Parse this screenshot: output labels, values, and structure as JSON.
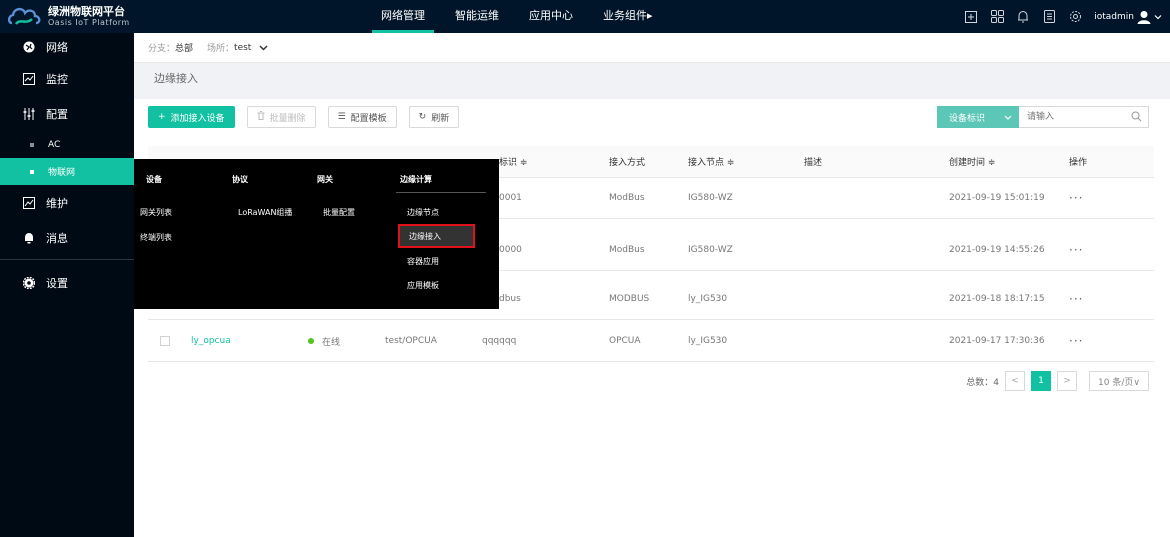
{
  "brand": {
    "title": "绿洲物联网平台",
    "subtitle": "Oasis IoT Platform",
    "accent": "#12c0a2",
    "logo_icon": "cloud-logo-icon"
  },
  "top_nav": {
    "items": [
      {
        "label": "网络管理",
        "active": true
      },
      {
        "label": "智能运维",
        "active": false
      },
      {
        "label": "应用中心",
        "active": false
      },
      {
        "label": "业务组件▸",
        "active": false
      }
    ]
  },
  "top_right": {
    "icons": [
      "fullscreen-icon",
      "apps-grid-icon",
      "bell-icon",
      "document-icon",
      "settings-gear-icon"
    ],
    "username": "iotadmin"
  },
  "sidebar": {
    "items": [
      {
        "label": "网络",
        "icon": "globe-icon"
      },
      {
        "label": "监控",
        "icon": "monitor-icon"
      },
      {
        "label": "配置",
        "icon": "sliders-icon"
      },
      {
        "label": "AC",
        "sub": true
      },
      {
        "label": "物联网",
        "sub": true,
        "active": true
      },
      {
        "label": "维护",
        "icon": "maintenance-icon"
      },
      {
        "label": "消息",
        "icon": "bell-icon"
      },
      {
        "label": "设置",
        "icon": "gear-icon"
      }
    ]
  },
  "breadcrumb": {
    "branch_label": "分支：",
    "branch_value": "总部",
    "site_label": "场所：",
    "site_value": "test"
  },
  "page_title": "边缘接入",
  "toolbar": {
    "add_label": "添加接入设备",
    "batch_delete_label": "批量删除",
    "template_label": "配置模板",
    "refresh_label": "刷新"
  },
  "search": {
    "select_label": "设备标识",
    "placeholder": "请输入"
  },
  "table": {
    "headers": {
      "identifier": "标识 ≑",
      "access_method": "接入方式",
      "access_node": "接入节点 ≑",
      "description": "描述",
      "created": "创建时间 ≑",
      "actions": "操作"
    },
    "rows": [
      {
        "name": "",
        "status": "",
        "path": "",
        "identifier": "0001",
        "method": "ModBus",
        "node": "IG580-WZ",
        "created": "2021-09-19 15:01:19"
      },
      {
        "name": "",
        "status": "",
        "path": "",
        "identifier": "0000",
        "method": "ModBus",
        "node": "IG580-WZ",
        "created": "2021-09-19 14:55:26"
      },
      {
        "name": "",
        "status": "",
        "path": "",
        "identifier": "dbus",
        "method": "MODBUS",
        "node": "ly_IG530",
        "created": "2021-09-18 18:17:15"
      },
      {
        "name": "ly_opcua",
        "status": "在线",
        "path": "test/OPCUA",
        "identifier": "qqqqqq",
        "method": "OPCUA",
        "node": "ly_IG530",
        "created": "2021-09-17 17:30:36"
      }
    ],
    "more_label": "···"
  },
  "pagination": {
    "total_label": "总数：4",
    "prev": "<",
    "current": "1",
    "next": ">",
    "page_size": "10 条/页∨"
  },
  "mega_menu": {
    "columns": [
      {
        "header": "设备",
        "items": [
          "网关列表",
          "终端列表"
        ]
      },
      {
        "header": "协议",
        "items": [
          "LoRaWAN组播"
        ]
      },
      {
        "header": "网关",
        "items": [
          "批量配置"
        ]
      },
      {
        "header": "边缘计算",
        "items": [
          "边缘节点",
          "边缘接入",
          "容器应用",
          "应用模板"
        ]
      }
    ],
    "highlighted": "边缘接入",
    "highlight_color": "#e0111b"
  }
}
